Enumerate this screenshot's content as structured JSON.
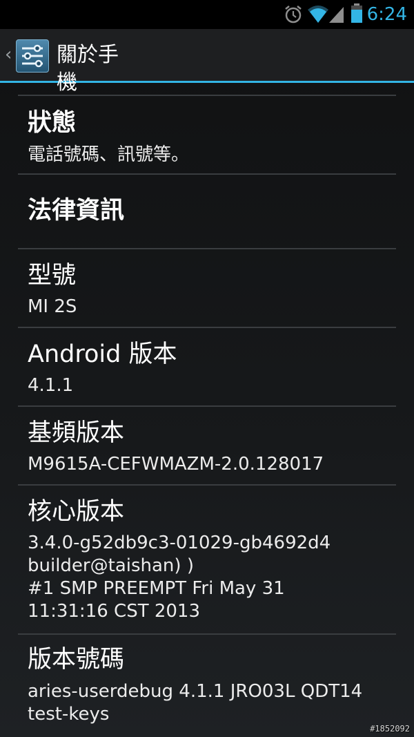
{
  "status_bar": {
    "time": "6:24",
    "icons": [
      "alarm-icon",
      "wifi-icon",
      "signal-icon",
      "battery-icon"
    ]
  },
  "action_bar": {
    "title": "關於手機",
    "icon": "settings-sliders-icon",
    "accent": "#33b5e5"
  },
  "items": [
    {
      "title": "狀態",
      "summary": "電話號碼、訊號等。"
    },
    {
      "title": "法律資訊",
      "summary": ""
    },
    {
      "title": "型號",
      "summary": "MI 2S"
    },
    {
      "title": "Android 版本",
      "summary": "4.1.1"
    },
    {
      "title": "基頻版本",
      "summary": "M9615A-CEFWMAZM-2.0.128017"
    },
    {
      "title": "核心版本",
      "summary": "3.4.0-g52db9c3-01029-gb4692d4\nbuilder@taishan) )\n#1 SMP PREEMPT Fri May 31\n11:31:16 CST 2013"
    },
    {
      "title": "版本號碼",
      "summary": "aries-userdebug 4.1.1 JRO03L QDT14\ntest-keys"
    }
  ],
  "watermark": "#1852092"
}
